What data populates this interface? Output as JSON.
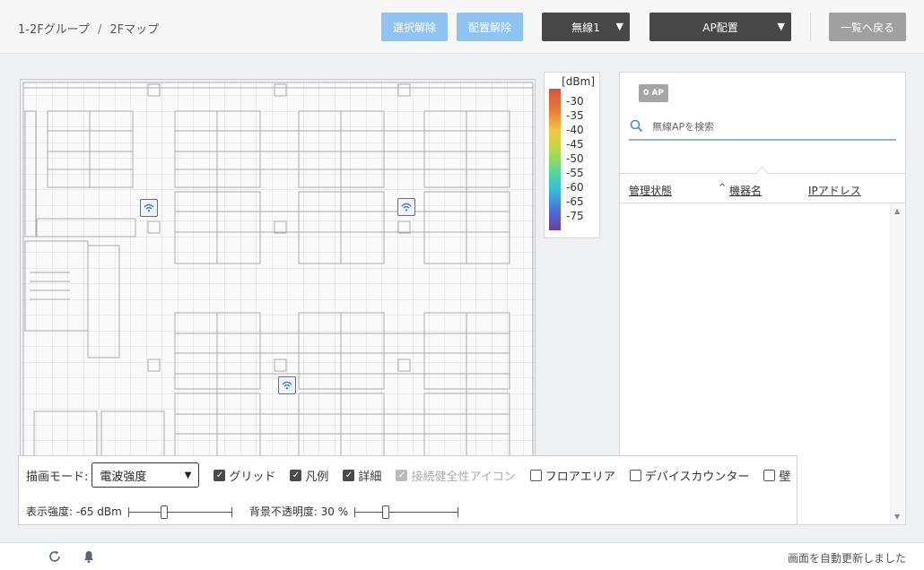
{
  "breadcrumb": {
    "group": "1-2Fグループ",
    "separator": "/",
    "map": "2Fマップ"
  },
  "toolbar": {
    "deselect_label": "選択解除",
    "unplace_label": "配置解除",
    "wireless_select": "無線1",
    "ap_place_select": "AP配置",
    "back_label": "一覧へ戻る"
  },
  "legend": {
    "unit": "[dBm]",
    "ticks": [
      "-30",
      "-35",
      "-40",
      "-45",
      "-50",
      "-55",
      "-60",
      "-65",
      "-75"
    ]
  },
  "panel": {
    "ap_count_badge": "0 AP",
    "search_placeholder": "無線APを検索",
    "columns": {
      "status": "管理状態",
      "sort_indicator": "^",
      "device": "機器名",
      "ip": "IPアドレス"
    }
  },
  "controls": {
    "draw_mode_label": "描画モード:",
    "draw_mode_value": "電波強度",
    "checkboxes": {
      "grid": "グリッド",
      "legend": "凡例",
      "detail": "詳細",
      "health_icon": "接続健全性アイコン",
      "floor_area": "フロアエリア",
      "device_counter": "デバイスカウンター",
      "wall": "壁"
    },
    "strength_label": "表示強度: -65 dBm",
    "opacity_label": "背景不透明度: 30 %"
  },
  "status": {
    "message": "画面を自動更新しました"
  },
  "colors": {
    "primary_light": "#8fc4f2",
    "dark": "#474747",
    "gray": "#a0a0a0"
  },
  "icons": [
    "wifi-icon",
    "search-icon",
    "refresh-icon",
    "bell-icon"
  ]
}
